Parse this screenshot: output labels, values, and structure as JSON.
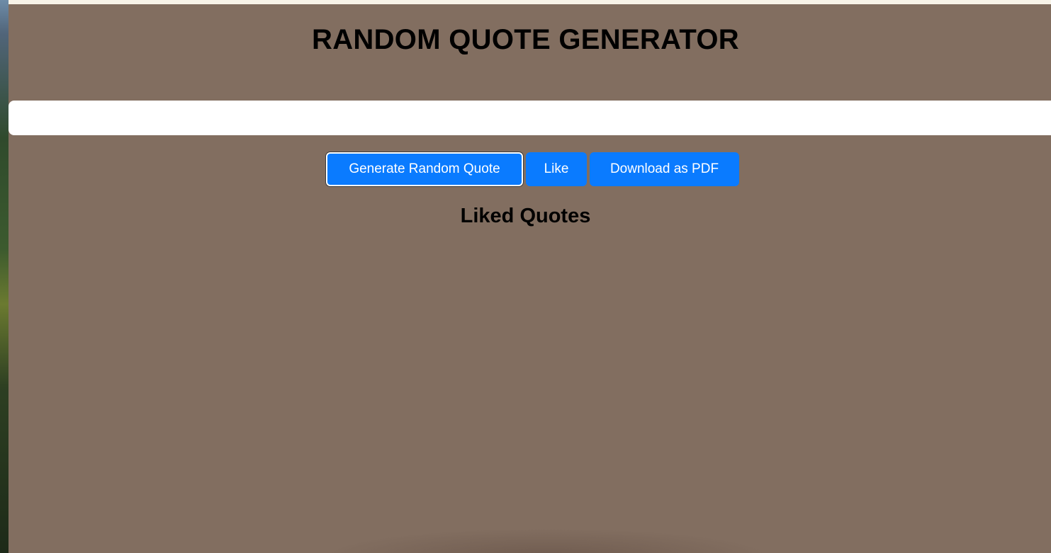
{
  "header": {
    "title": "RANDOM QUOTE GENERATOR"
  },
  "quote": {
    "text": ""
  },
  "buttons": {
    "generate_label": "Generate Random Quote",
    "like_label": "Like",
    "download_label": "Download as PDF"
  },
  "liked": {
    "title": "Liked Quotes",
    "items": []
  },
  "colors": {
    "page_background": "#826e60",
    "button_background": "#0a7bff",
    "button_text": "#ffffff",
    "quote_box": "#ffffff"
  }
}
